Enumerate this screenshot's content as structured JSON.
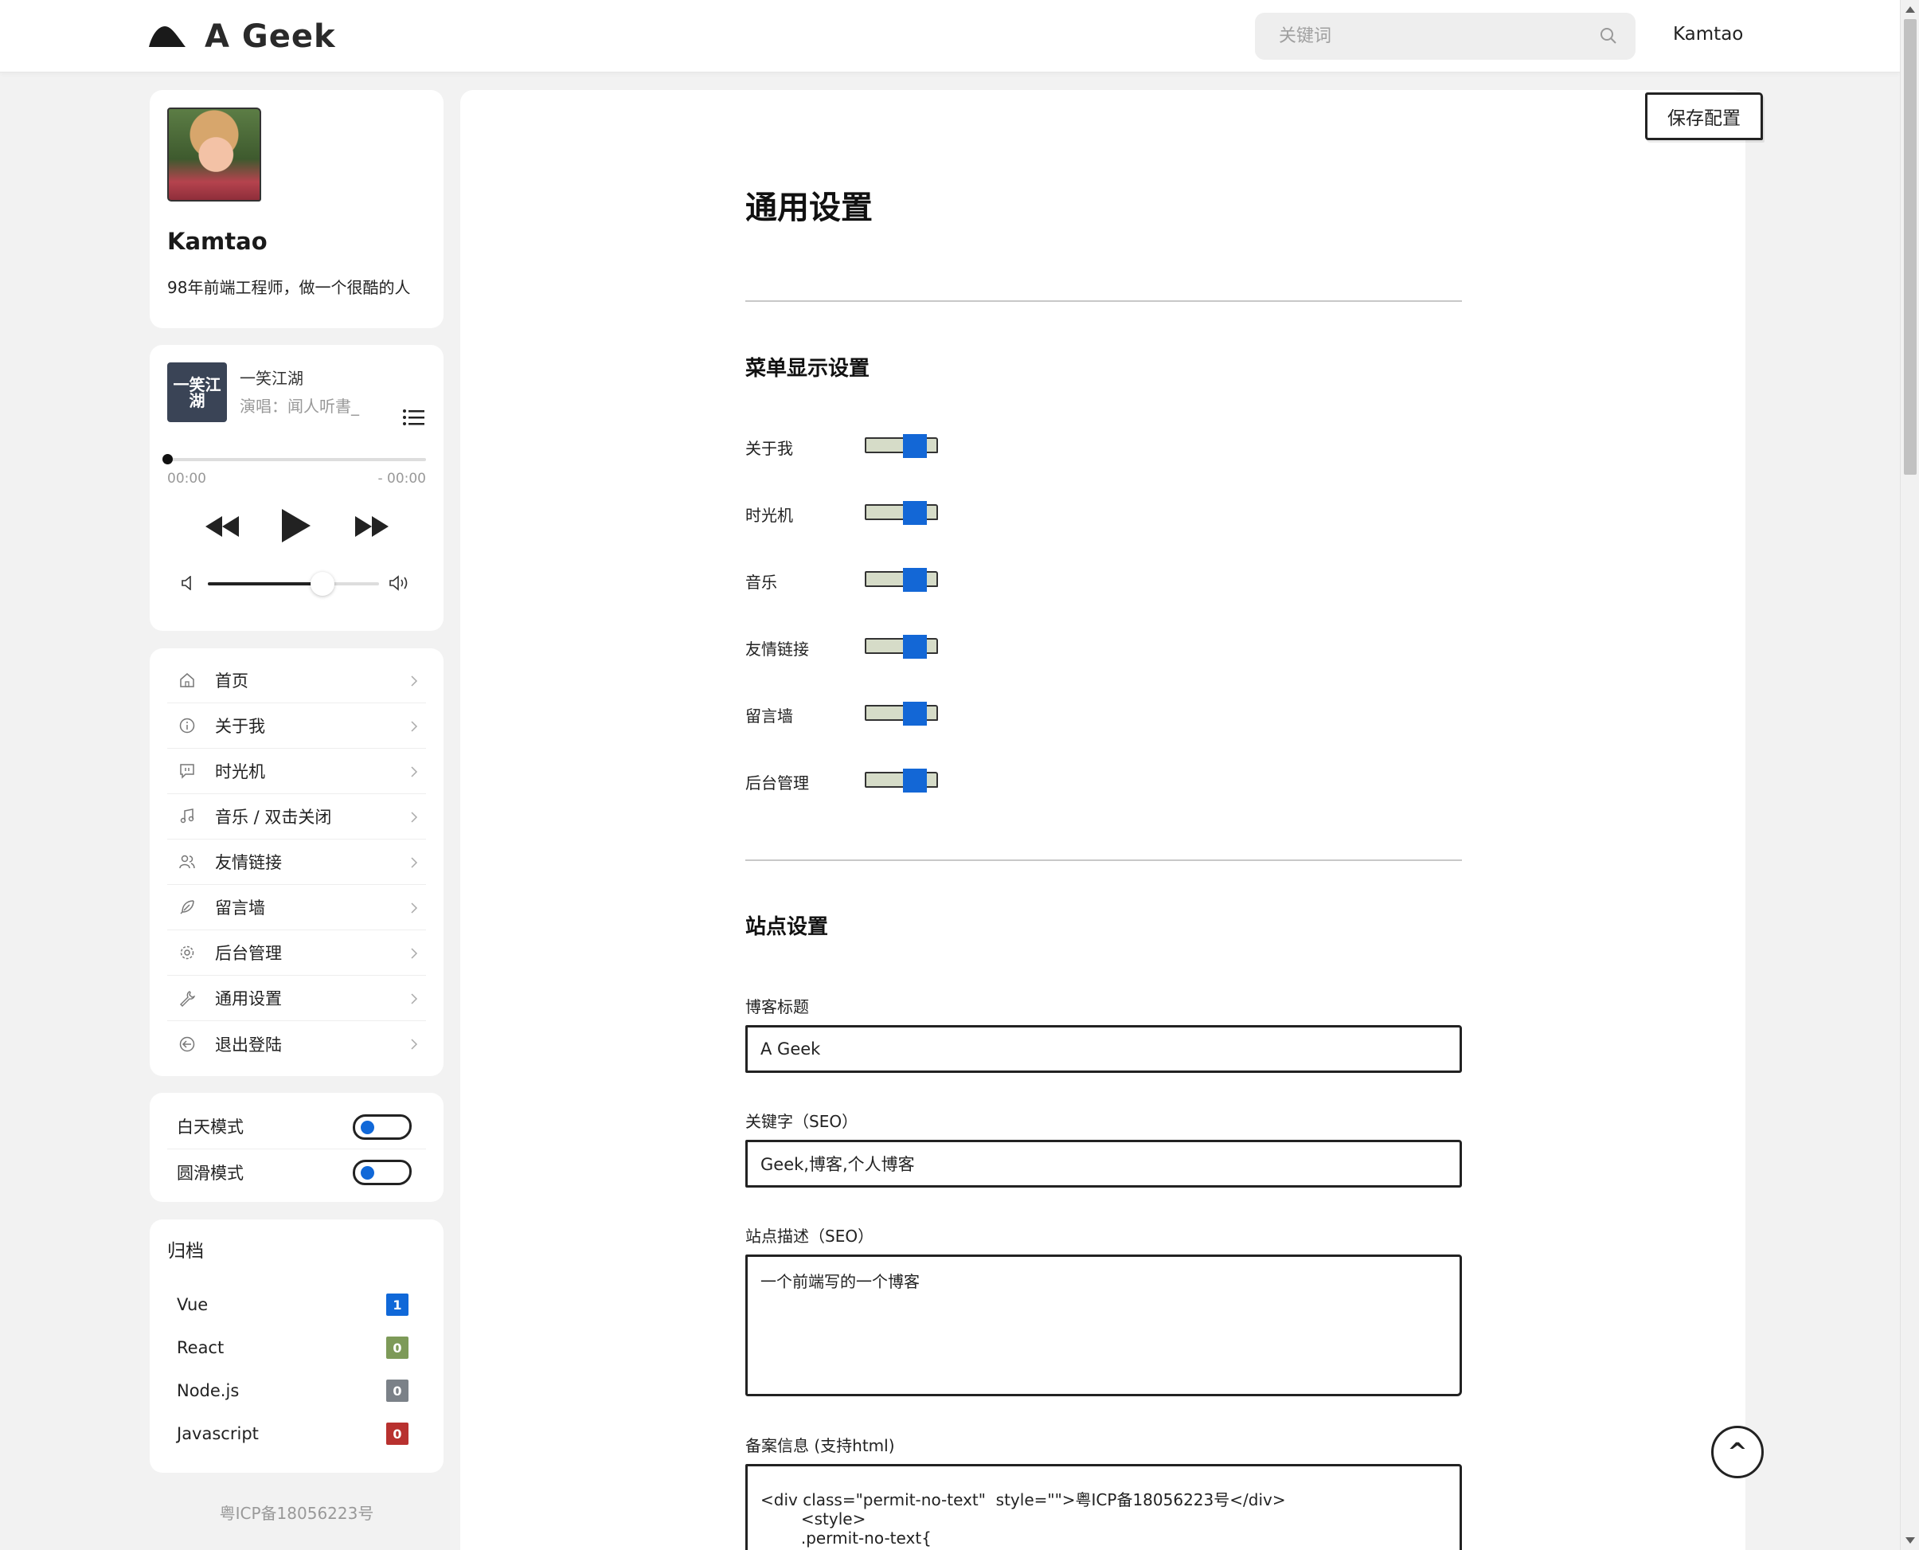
{
  "header": {
    "logo_text": "A Geek",
    "search_placeholder": "关键词",
    "user_name": "Kamtao"
  },
  "profile": {
    "name": "Kamtao",
    "bio": "98年前端工程师，做一个很酷的人"
  },
  "player": {
    "cover_text": "一笑江湖",
    "song_title": "一笑江湖",
    "artist": "演唱：闻人听書_",
    "time_current": "00:00",
    "time_remaining": "- 00:00",
    "progress": 0,
    "volume": 0.67
  },
  "nav": {
    "items": [
      {
        "label": "首页",
        "icon": "home-icon"
      },
      {
        "label": "关于我",
        "icon": "info-icon"
      },
      {
        "label": "时光机",
        "icon": "message-icon"
      },
      {
        "label": "音乐 / 双击关闭",
        "icon": "music-icon"
      },
      {
        "label": "友情链接",
        "icon": "users-icon"
      },
      {
        "label": "留言墙",
        "icon": "feather-icon"
      },
      {
        "label": "后台管理",
        "icon": "gear-icon"
      },
      {
        "label": "通用设置",
        "icon": "wrench-icon"
      },
      {
        "label": "退出登陆",
        "icon": "logout-icon"
      }
    ]
  },
  "modes": {
    "day_label": "白天模式",
    "smooth_label": "圆滑模式"
  },
  "archive": {
    "title": "归档",
    "items": [
      {
        "label": "Vue",
        "count": "1",
        "color": "#1068d8"
      },
      {
        "label": "React",
        "count": "0",
        "color": "#7d9a58"
      },
      {
        "label": "Node.js",
        "count": "0",
        "color": "#7b8188"
      },
      {
        "label": "Javascript",
        "count": "0",
        "color": "#b8312f"
      }
    ]
  },
  "footer": {
    "icp": "粤ICP备18056223号"
  },
  "main": {
    "save_label": "保存配置",
    "page_title": "通用设置",
    "menu_section_title": "菜单显示设置",
    "menu_items": [
      "关于我",
      "时光机",
      "音乐",
      "友情链接",
      "留言墙",
      "后台管理"
    ],
    "site_section_title": "站点设置",
    "blog_title_label": "博客标题",
    "blog_title_value": "A Geek",
    "keywords_label": "关键字（SEO）",
    "keywords_value": "Geek,博客,个人博客",
    "description_label": "站点描述（SEO）",
    "description_value": "一个前端写的一个博客",
    "record_label": "备案信息 (支持html)",
    "record_value": "<div class=\"permit-no-text\"  style=\"\">粤ICP备18056223号</div>\n        <style>\n        .permit-no-text{",
    "back_top_label": "^"
  },
  "colors": {
    "accent": "#1068d8",
    "slider_track": "#d6dcc8"
  }
}
